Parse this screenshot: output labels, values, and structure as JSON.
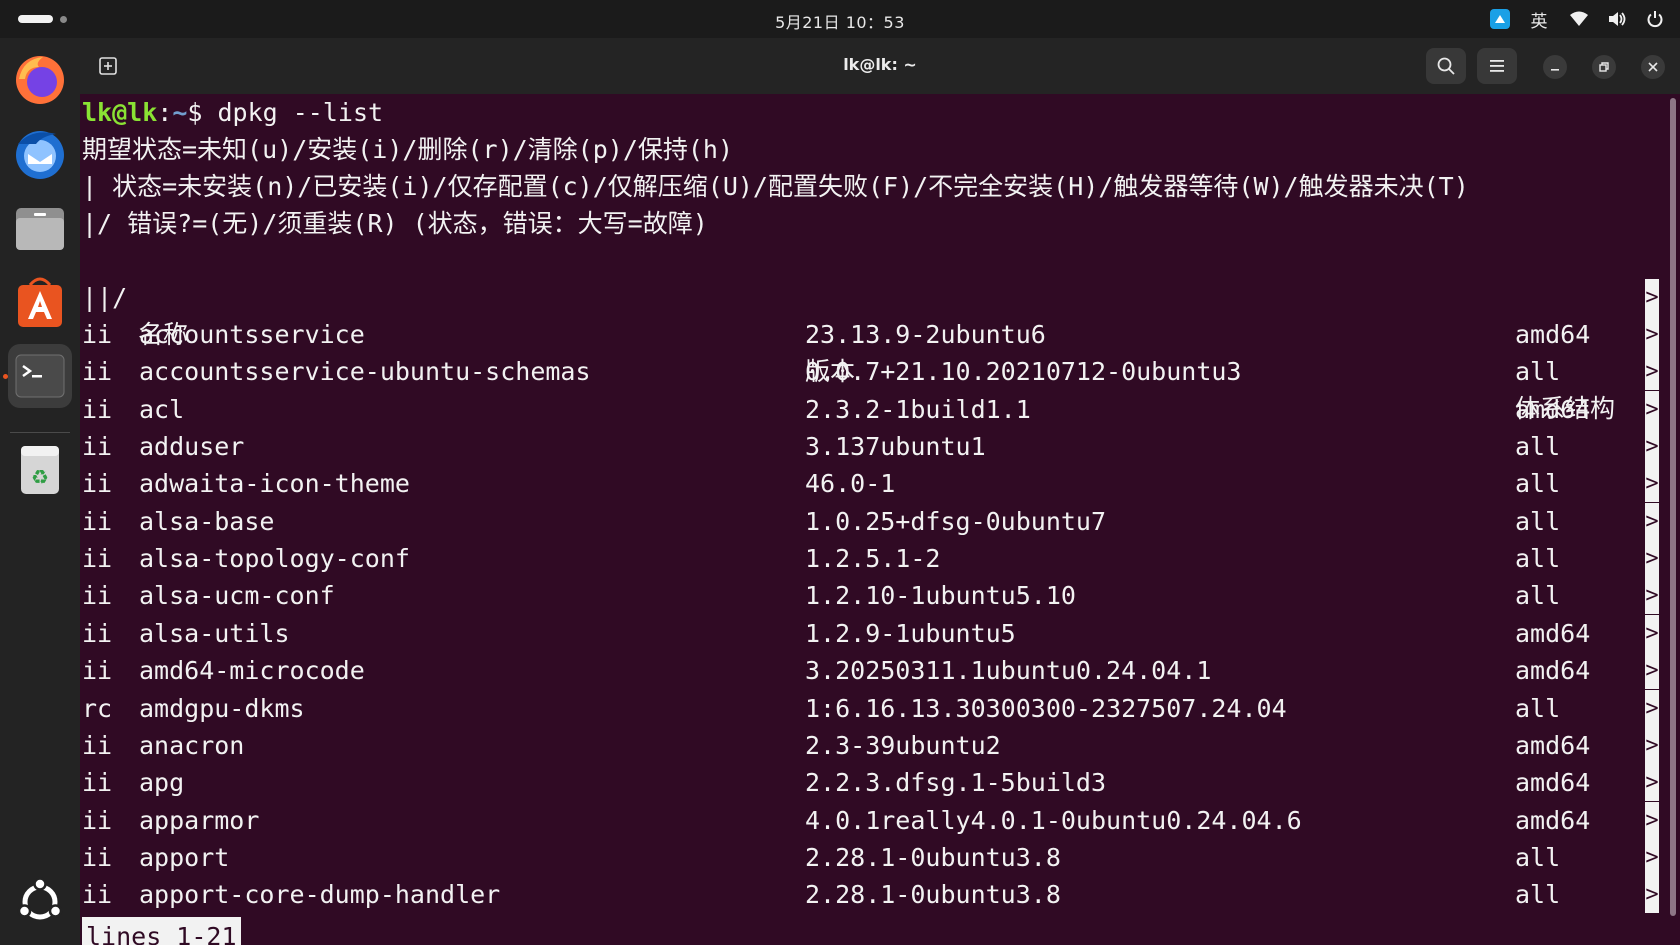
{
  "topbar": {
    "clock": "5月21日 10：53",
    "ime_label": "英",
    "icons": [
      "workspace-indicator",
      "app-tray-icon",
      "wifi-icon",
      "volume-icon",
      "power-icon"
    ]
  },
  "dock": {
    "items": [
      {
        "name": "firefox",
        "icon": "firefox-icon"
      },
      {
        "name": "thunderbird",
        "icon": "thunderbird-icon"
      },
      {
        "name": "files",
        "icon": "files-icon"
      },
      {
        "name": "app-center",
        "icon": "app-center-icon"
      },
      {
        "name": "terminal",
        "icon": "terminal-icon",
        "active": true
      },
      {
        "name": "trash",
        "icon": "trash-icon"
      },
      {
        "name": "show-apps",
        "icon": "ubuntu-logo-icon"
      }
    ]
  },
  "window": {
    "title": "lk@lk: ~"
  },
  "terminal": {
    "prompt_user": "lk@lk",
    "prompt_sep": ":",
    "prompt_path": "~",
    "prompt_symbol": "$ ",
    "command": "dpkg --list",
    "header_lines": [
      "期望状态=未知(u)/安装(i)/删除(r)/清除(p)/保持(h)",
      "| 状态=未安装(n)/已安装(i)/仅存配置(c)/仅解压缩(U)/配置失败(F)/不完全安装(H)/触发器等待(W)/触发器未决(T)",
      "|/ 错误?=(无)/须重装(R) (状态，错误：大写=故障)"
    ],
    "columns": {
      "prefix": "||/",
      "name": "名称",
      "version": "版本",
      "arch": "体系结构"
    },
    "separator": "+++-==============================================-=========================================-==========",
    "truncation_marker": ">",
    "rows": [
      {
        "status": "ii",
        "name": "accountsservice",
        "version": "23.13.9-2ubuntu6",
        "arch": "amd64"
      },
      {
        "status": "ii",
        "name": "accountsservice-ubuntu-schemas",
        "version": "0.0.7+21.10.20210712-0ubuntu3",
        "arch": "all"
      },
      {
        "status": "ii",
        "name": "acl",
        "version": "2.3.2-1build1.1",
        "arch": "amd64"
      },
      {
        "status": "ii",
        "name": "adduser",
        "version": "3.137ubuntu1",
        "arch": "all"
      },
      {
        "status": "ii",
        "name": "adwaita-icon-theme",
        "version": "46.0-1",
        "arch": "all"
      },
      {
        "status": "ii",
        "name": "alsa-base",
        "version": "1.0.25+dfsg-0ubuntu7",
        "arch": "all"
      },
      {
        "status": "ii",
        "name": "alsa-topology-conf",
        "version": "1.2.5.1-2",
        "arch": "all"
      },
      {
        "status": "ii",
        "name": "alsa-ucm-conf",
        "version": "1.2.10-1ubuntu5.10",
        "arch": "all"
      },
      {
        "status": "ii",
        "name": "alsa-utils",
        "version": "1.2.9-1ubuntu5",
        "arch": "amd64"
      },
      {
        "status": "ii",
        "name": "amd64-microcode",
        "version": "3.20250311.1ubuntu0.24.04.1",
        "arch": "amd64"
      },
      {
        "status": "rc",
        "name": "amdgpu-dkms",
        "version": "1:6.16.13.30300300-2327507.24.04",
        "arch": "all"
      },
      {
        "status": "ii",
        "name": "anacron",
        "version": "2.3-39ubuntu2",
        "arch": "amd64"
      },
      {
        "status": "ii",
        "name": "apg",
        "version": "2.2.3.dfsg.1-5build3",
        "arch": "amd64"
      },
      {
        "status": "ii",
        "name": "apparmor",
        "version": "4.0.1really4.0.1-0ubuntu0.24.04.6",
        "arch": "amd64"
      },
      {
        "status": "ii",
        "name": "apport",
        "version": "2.28.1-0ubuntu3.8",
        "arch": "all"
      },
      {
        "status": "ii",
        "name": "apport-core-dump-handler",
        "version": "2.28.1-0ubuntu3.8",
        "arch": "all"
      }
    ],
    "pager_status": "lines 1-21"
  }
}
